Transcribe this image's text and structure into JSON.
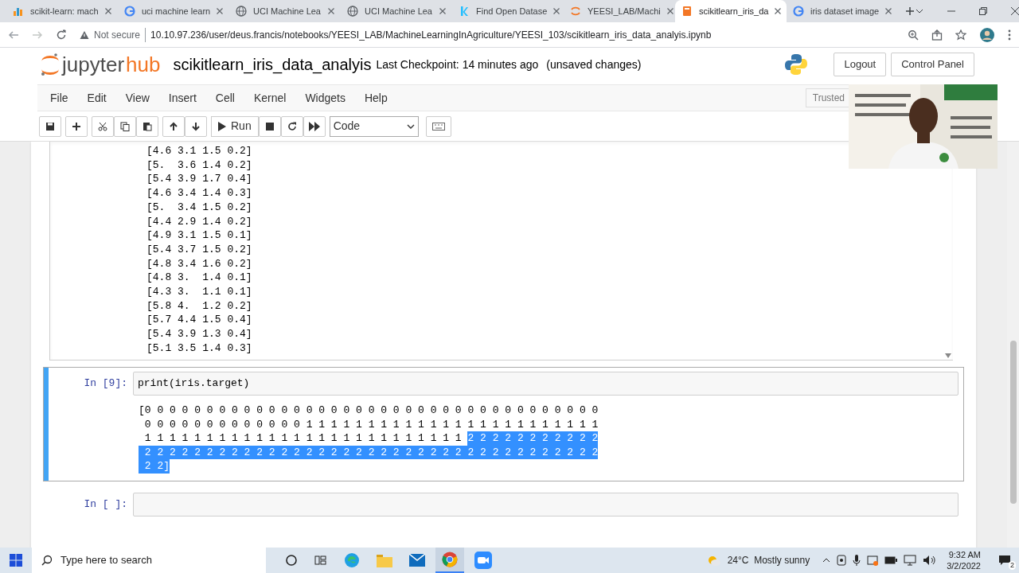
{
  "browser": {
    "tabs": [
      {
        "title": "scikit-learn: mach",
        "selected": false
      },
      {
        "title": "uci machine learn",
        "selected": false
      },
      {
        "title": "UCI Machine Lea",
        "selected": false
      },
      {
        "title": "UCI Machine Lea",
        "selected": false
      },
      {
        "title": "Find Open Datase",
        "selected": false
      },
      {
        "title": "YEESI_LAB/Machi",
        "selected": false
      },
      {
        "title": "scikitlearn_iris_da",
        "selected": true
      },
      {
        "title": "iris dataset image",
        "selected": false
      }
    ],
    "security": "Not secure",
    "url": "10.10.97.236/user/deus.francis/notebooks/YEESI_LAB/MachineLearningInAgriculture/YEESI_103/scikitlearn_iris_data_analyis.ipynb"
  },
  "header": {
    "logo_word_1": "jupyter",
    "logo_word_2": "hub",
    "notebook_name": "scikitlearn_iris_data_analyis",
    "checkpoint": "Last Checkpoint: 14 minutes ago",
    "save_state": "(unsaved changes)",
    "buttons": [
      "Logout",
      "Control Panel"
    ]
  },
  "menu": {
    "items": [
      "File",
      "Edit",
      "View",
      "Insert",
      "Cell",
      "Kernel",
      "Widgets",
      "Help"
    ],
    "trusted": "Trusted"
  },
  "toolbar": {
    "run_label": "Run",
    "cell_type": "Code"
  },
  "cells": [
    {
      "kind": "output_scroll",
      "lines": [
        "[4.6 3.1 1.5 0.2]",
        "[5.  3.6 1.4 0.2]",
        "[5.4 3.9 1.7 0.4]",
        "[4.6 3.4 1.4 0.3]",
        "[5.  3.4 1.5 0.2]",
        "[4.4 2.9 1.4 0.2]",
        "[4.9 3.1 1.5 0.1]",
        "[5.4 3.7 1.5 0.2]",
        "[4.8 3.4 1.6 0.2]",
        "[4.8 3.  1.4 0.1]",
        "[4.3 3.  1.1 0.1]",
        "[5.8 4.  1.2 0.2]",
        "[5.7 4.4 1.5 0.4]",
        "[5.4 3.9 1.3 0.4]",
        "[5.1 3.5 1.4 0.3]"
      ]
    },
    {
      "kind": "code",
      "selected": true,
      "prompt": "In [9]:",
      "source": "print(iris.target)",
      "output": [
        [
          {
            "text": "[0 0 0 0 0 0 0 0 0 0 0 0 0 0 0 0 0 0 0 0 0 0 0 0 0 0 0 0 0 0 0 0 0 0 0 0 0",
            "selected": false
          }
        ],
        [
          {
            "text": " 0 0 0 0 0 0 0 0 0 0 0 0 0 1 1 1 1 1 1 1 1 1 1 1 1 1 1 1 1 1 1 1 1 1 1 1 1",
            "selected": false
          }
        ],
        [
          {
            "text": " 1 1 1 1 1 1 1 1 1 1 1 1 1 1 1 1 1 1 1 1 1 1 1 1 1 1 ",
            "selected": false
          },
          {
            "text": "2 2 2 2 2 2 2 2 2 2 2",
            "selected": true
          }
        ],
        [
          {
            "text": " 2 2 2 2 2 2 2 2 2 2 2 2 2 2 2 2 2 2 2 2 2 2 2 2 2 2 2 2 2 2 2 2 2 2 2 2 2",
            "selected": true
          }
        ],
        [
          {
            "text": " 2 2]",
            "selected": true
          }
        ]
      ]
    },
    {
      "kind": "code",
      "selected": false,
      "prompt": "In [ ]:"
    }
  ],
  "taskbar": {
    "search_placeholder": "Type here to search",
    "weather": "24°C  Mostly sunny",
    "time": "9:32 AM",
    "date": "3/2/2022",
    "notifications": "2"
  }
}
